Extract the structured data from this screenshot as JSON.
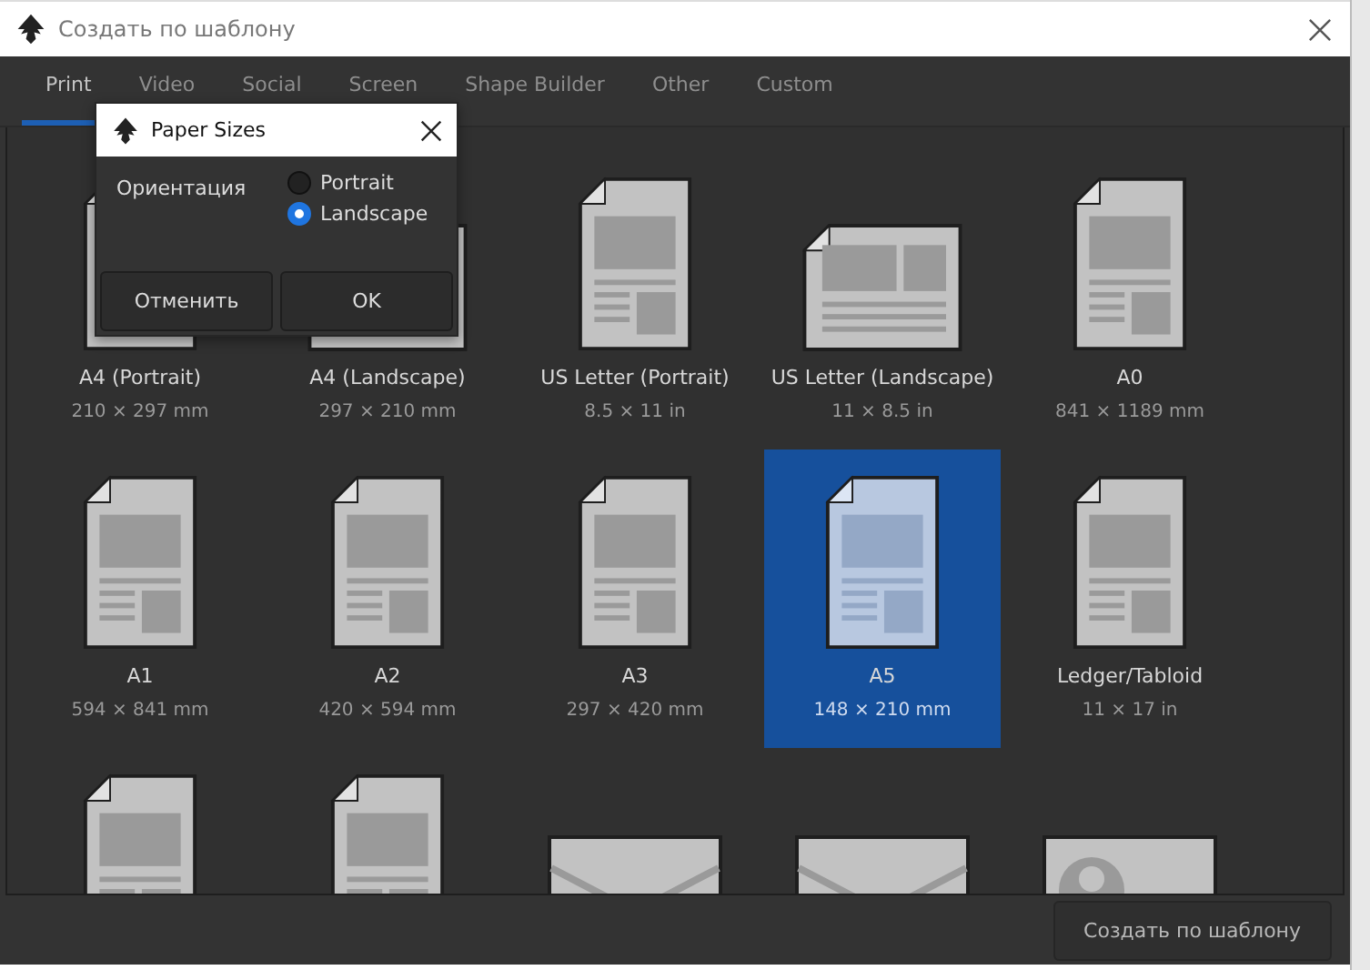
{
  "window": {
    "title": "Создать по шаблону"
  },
  "tabs": [
    {
      "label": "Print",
      "selected": true
    },
    {
      "label": "Video",
      "selected": false
    },
    {
      "label": "Social",
      "selected": false
    },
    {
      "label": "Screen",
      "selected": false
    },
    {
      "label": "Shape Builder",
      "selected": false
    },
    {
      "label": "Other",
      "selected": false
    },
    {
      "label": "Custom",
      "selected": false
    }
  ],
  "templates": [
    {
      "kind": "page",
      "name": "A4 (Portrait)",
      "size": "210 × 297 mm",
      "selected": false
    },
    {
      "kind": "landscape",
      "name": "A4 (Landscape)",
      "size": "297 × 210 mm",
      "selected": false
    },
    {
      "kind": "page",
      "name": "US Letter (Portrait)",
      "size": "8.5 × 11 in",
      "selected": false
    },
    {
      "kind": "landscape",
      "name": "US Letter (Landscape)",
      "size": "11 × 8.5 in",
      "selected": false
    },
    {
      "kind": "page",
      "name": "A0",
      "size": "841 × 1189 mm",
      "selected": false
    },
    {
      "kind": "page",
      "name": "A1",
      "size": "594 × 841 mm",
      "selected": false
    },
    {
      "kind": "page",
      "name": "A2",
      "size": "420 × 594 mm",
      "selected": false
    },
    {
      "kind": "page",
      "name": "A3",
      "size": "297 × 420 mm",
      "selected": false
    },
    {
      "kind": "page",
      "name": "A5",
      "size": "148 × 210 mm",
      "selected": true
    },
    {
      "kind": "page",
      "name": "Ledger/Tabloid",
      "size": "11 × 17 in",
      "selected": false
    },
    {
      "kind": "page",
      "selected": false
    },
    {
      "kind": "page",
      "selected": false
    },
    {
      "kind": "envelope",
      "selected": false
    },
    {
      "kind": "envelope",
      "selected": false
    },
    {
      "kind": "card",
      "selected": false
    }
  ],
  "create_button": "Создать по шаблону",
  "popup": {
    "title": "Paper Sizes",
    "label": "Ориентация",
    "options": [
      {
        "label": "Portrait",
        "selected": false
      },
      {
        "label": "Landscape",
        "selected": true
      }
    ],
    "buttons": [
      "Отменить",
      "OK"
    ]
  }
}
